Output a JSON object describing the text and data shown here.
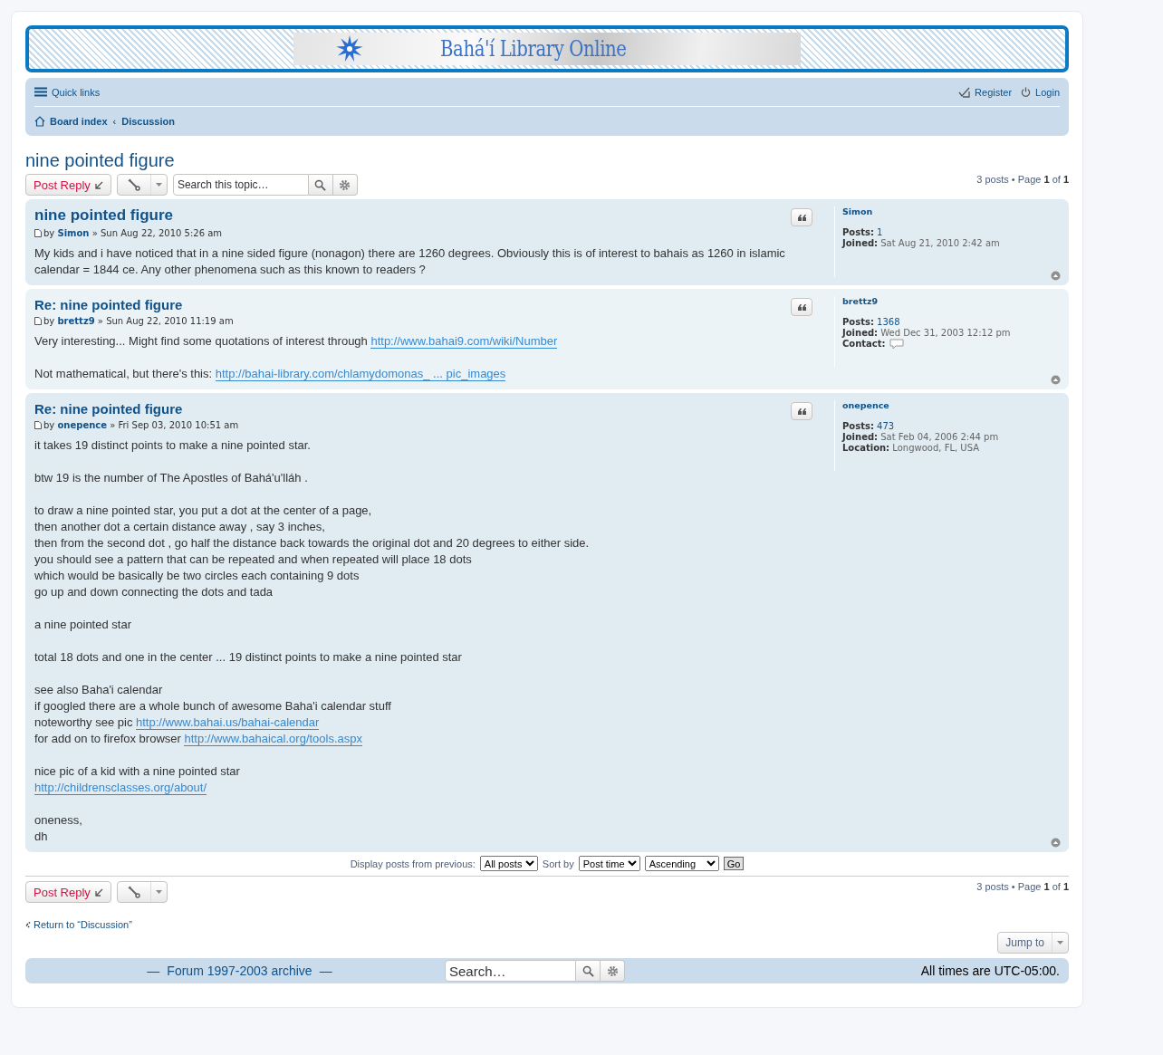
{
  "header": {
    "logo_text": "Bahá'í Library Online"
  },
  "navbar": {
    "quick_links": "Quick links",
    "register": "Register",
    "login": "Login",
    "breadcrumbs": [
      "Board index",
      "Discussion"
    ],
    "breadcrumb_separator": "‹"
  },
  "topic": {
    "title": "nine pointed figure",
    "post_reply": "Post Reply",
    "search_placeholder": "Search this topic…",
    "pagination": {
      "count": "3 posts • Page ",
      "page": "1",
      "of": " of ",
      "total": "1"
    }
  },
  "posts": [
    {
      "title": "nine pointed figure",
      "by": "by",
      "author": "Simon",
      "date": " » Sun Aug 22, 2010 5:26 am",
      "paragraphs": [
        [
          [
            {
              "kind": "text",
              "text": "My kids and i have noticed that in a nine sided figure (nonagon) there are 1260 degrees. Obviously this is of interest to bahais as 1260 in islamic calendar = 1844 ce. Any other phenomena such as this known to readers ?"
            }
          ]
        ]
      ],
      "profile": {
        "name": "Simon",
        "fields": [
          {
            "kind": "link",
            "label": "Posts:",
            "value": "1"
          },
          {
            "kind": "text",
            "label": "Joined:",
            "value": "Sat Aug 21, 2010 2:42 am"
          }
        ]
      }
    },
    {
      "title": "Re: nine pointed figure",
      "by": "by",
      "author": "brettz9",
      "date": " » Sun Aug 22, 2010 11:19 am",
      "paragraphs": [
        [
          [
            {
              "kind": "text",
              "text": "Very interesting... Might find some quotations of interest through "
            },
            {
              "kind": "link",
              "text": "http://www.bahai9.com/wiki/Number"
            }
          ]
        ],
        [
          [
            {
              "kind": "text",
              "text": "Not mathematical, but there's this: "
            },
            {
              "kind": "link",
              "text": "http://bahai-library.com/chlamydomonas_ ... pic_images"
            }
          ]
        ]
      ],
      "profile": {
        "name": "brettz9",
        "fields": [
          {
            "kind": "link",
            "label": "Posts:",
            "value": "1368"
          },
          {
            "kind": "text",
            "label": "Joined:",
            "value": "Wed Dec 31, 2003 12:12 pm"
          },
          {
            "kind": "contact",
            "label": "Contact:"
          }
        ]
      }
    },
    {
      "title": "Re: nine pointed figure",
      "by": "by",
      "author": "onepence",
      "date": " » Fri Sep 03, 2010 10:51 am",
      "paragraphs": [
        [
          [
            {
              "kind": "text",
              "text": "it takes 19 distinct points to make a nine pointed star."
            }
          ]
        ],
        [
          [
            {
              "kind": "text",
              "text": "btw 19 is the number of The Apostles of Bahá'u'lláh ."
            }
          ]
        ],
        [
          [
            {
              "kind": "text",
              "text": "to draw a nine pointed star, you put a dot at the center of a page,"
            }
          ],
          [
            {
              "kind": "text",
              "text": "then another dot a certain distance away , say 3 inches,"
            }
          ],
          [
            {
              "kind": "text",
              "text": "then from the second dot , go half the distance back towards the original dot and 20 degrees to either side."
            }
          ],
          [
            {
              "kind": "text",
              "text": "you should see a pattern that can be repeated and when repeated will place 18 dots"
            }
          ],
          [
            {
              "kind": "text",
              "text": "which would be basically be two circles each containing 9 dots"
            }
          ],
          [
            {
              "kind": "text",
              "text": "go up and down connecting the dots and tada"
            }
          ]
        ],
        [
          [
            {
              "kind": "text",
              "text": "a nine pointed star"
            }
          ]
        ],
        [
          [
            {
              "kind": "text",
              "text": "total 18 dots and one in the center ... 19 distinct points to make a nine pointed star"
            }
          ]
        ],
        [
          [
            {
              "kind": "text",
              "text": "see also Baha'i calendar"
            }
          ],
          [
            {
              "kind": "text",
              "text": "if googled there are a whole bunch of awesome Baha'i calendar stuff"
            }
          ],
          [
            {
              "kind": "text",
              "text": "noteworthy see pic "
            },
            {
              "kind": "link",
              "text": "http://www.bahai.us/bahai-calendar"
            }
          ],
          [
            {
              "kind": "text",
              "text": "for add on to firefox browser "
            },
            {
              "kind": "link",
              "text": "http://www.bahaical.org/tools.aspx"
            }
          ]
        ],
        [
          [
            {
              "kind": "text",
              "text": "nice pic of a kid with a nine pointed star"
            }
          ],
          [
            {
              "kind": "link",
              "text": "http://childrensclasses.org/about/"
            }
          ]
        ],
        [
          [
            {
              "kind": "text",
              "text": "oneness,"
            }
          ],
          [
            {
              "kind": "text",
              "text": "dh"
            }
          ]
        ]
      ],
      "profile": {
        "name": "onepence",
        "fields": [
          {
            "kind": "link",
            "label": "Posts:",
            "value": "473"
          },
          {
            "kind": "text",
            "label": "Joined:",
            "value": "Sat Feb 04, 2006 2:44 pm"
          },
          {
            "kind": "text",
            "label": "Location:",
            "value": "Longwood, FL, USA"
          }
        ]
      }
    }
  ],
  "display_options": {
    "label": "Display posts from previous:",
    "days": "All posts",
    "sort_label": "Sort by",
    "sort_key": "Post time",
    "direction": "Ascending",
    "go": "Go"
  },
  "bottom": {
    "post_reply": "Post Reply",
    "pagination": {
      "count": "3 posts • Page ",
      "page": "1",
      "of": " of ",
      "total": "1"
    },
    "return_link": "Return to “Discussion”",
    "jump_to": "Jump to"
  },
  "footer": {
    "archive_link": "Forum 1997-2003 archive",
    "dash": "—",
    "search_placeholder": "Search…",
    "timezone": "All times are UTC-05:00."
  }
}
